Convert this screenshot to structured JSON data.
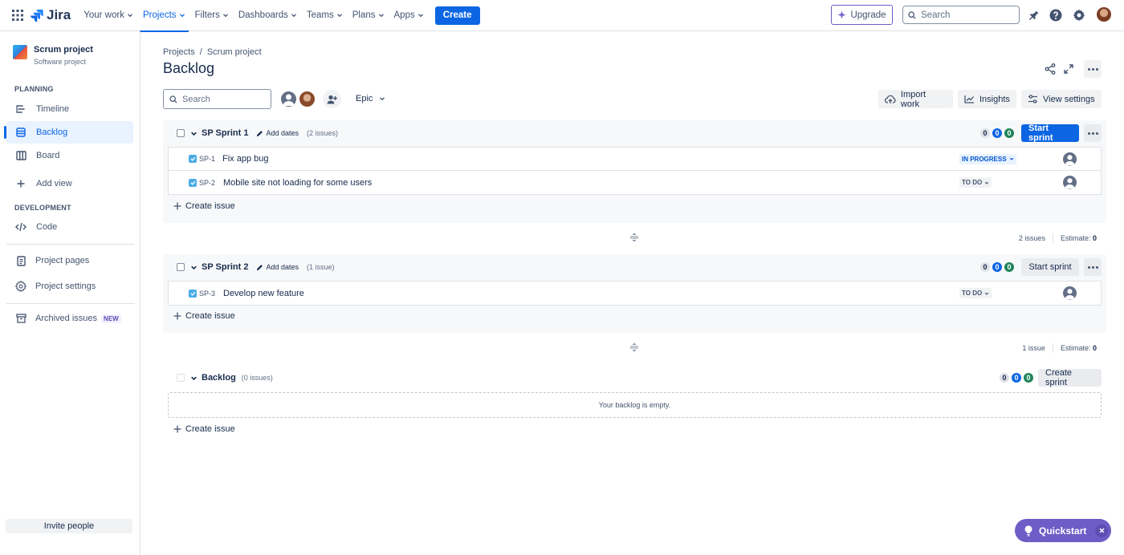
{
  "topnav": {
    "logo": "Jira",
    "items": [
      {
        "label": "Your work"
      },
      {
        "label": "Projects"
      },
      {
        "label": "Filters"
      },
      {
        "label": "Dashboards"
      },
      {
        "label": "Teams"
      },
      {
        "label": "Plans"
      },
      {
        "label": "Apps"
      }
    ],
    "active_item": "Projects",
    "create_label": "Create",
    "upgrade_label": "Upgrade",
    "search_placeholder": "Search"
  },
  "sidebar": {
    "project_name": "Scrum project",
    "project_type": "Software project",
    "planning_label": "PLANNING",
    "planning_items": [
      {
        "label": "Timeline",
        "icon": "timeline-icon"
      },
      {
        "label": "Backlog",
        "icon": "backlog-icon",
        "active": true
      },
      {
        "label": "Board",
        "icon": "board-icon"
      }
    ],
    "add_view_label": "Add view",
    "development_label": "DEVELOPMENT",
    "code_label": "Code",
    "project_pages_label": "Project pages",
    "project_settings_label": "Project settings",
    "archived_label": "Archived issues",
    "new_badge": "NEW",
    "invite_label": "Invite people"
  },
  "page": {
    "breadcrumb": [
      "Projects",
      "/",
      "Scrum project"
    ],
    "title": "Backlog",
    "search_placeholder": "Search",
    "epic_label": "Epic",
    "import_label": "Import work",
    "insights_label": "Insights",
    "view_settings_label": "View settings"
  },
  "sprints": [
    {
      "name": "SP Sprint 1",
      "add_dates": "Add dates",
      "count": "(2 issues)",
      "counts": [
        "0",
        "0",
        "0"
      ],
      "action": "Start sprint",
      "issues": [
        {
          "key": "SP-1",
          "summary": "Fix app bug",
          "status": "IN PROGRESS"
        },
        {
          "key": "SP-2",
          "summary": "Mobile site not loading for some users",
          "status": "TO DO"
        }
      ],
      "create_issue": "Create issue",
      "footer_issues": "2 issues",
      "estimate_label": "Estimate:",
      "estimate_value": "0"
    },
    {
      "name": "SP Sprint 2",
      "add_dates": "Add dates",
      "count": "(1 issue)",
      "counts": [
        "0",
        "0",
        "0"
      ],
      "action": "Start sprint",
      "issues": [
        {
          "key": "SP-3",
          "summary": "Develop new feature",
          "status": "TO DO"
        }
      ],
      "create_issue": "Create issue",
      "footer_issues": "1 issue",
      "estimate_label": "Estimate:",
      "estimate_value": "0"
    }
  ],
  "backlog": {
    "name": "Backlog",
    "count": "(0 issues)",
    "counts": [
      "0",
      "0",
      "0"
    ],
    "action": "Create sprint",
    "empty_text": "Your backlog is empty.",
    "create_issue": "Create issue"
  },
  "quickstart_label": "Quickstart",
  "colors": {
    "brand": "#0c66e4",
    "discovery": "#6e5dc6",
    "done": "#1f845a"
  }
}
